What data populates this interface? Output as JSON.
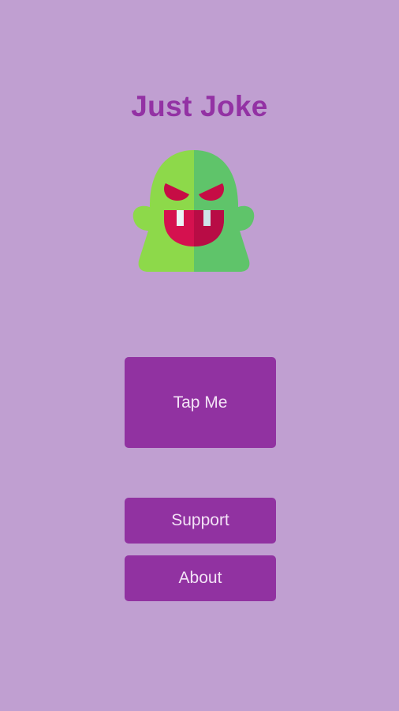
{
  "app": {
    "title": "Just Joke"
  },
  "mascot": {
    "icon": "green-monster-icon"
  },
  "buttons": {
    "tap_label": "Tap Me",
    "support_label": "Support",
    "about_label": "About"
  },
  "colors": {
    "background": "#c09fd1",
    "accent": "#9132a1",
    "title": "#9332a4",
    "button_text": "#f3e3f6",
    "monster_light": "#8dd94a",
    "monster_dark": "#5fc46a",
    "mouth": "#d5114f"
  }
}
